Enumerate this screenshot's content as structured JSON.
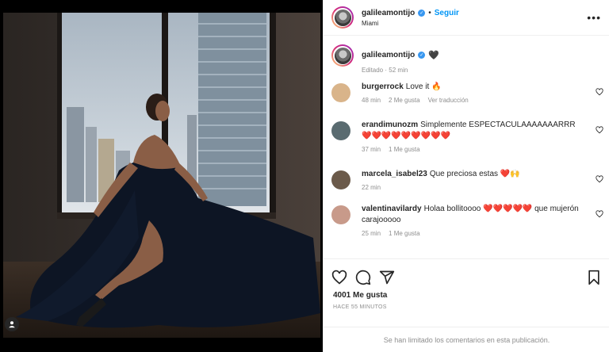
{
  "header": {
    "username": "galileamontijo",
    "separator": "•",
    "follow_label": "Seguir",
    "location": "Miami",
    "more_label": "•••"
  },
  "caption": {
    "username": "galileamontijo",
    "text": "🖤",
    "edited": "Editado",
    "separator": "·",
    "time": "52 min"
  },
  "comments": [
    {
      "username": "burgerrock",
      "text": "Love it 🔥",
      "time": "48 min",
      "likes": "2 Me gusta",
      "translate": "Ver traducción",
      "avatar_color": "#d9b48a"
    },
    {
      "username": "erandimunozm",
      "text": "Simplemente ESPECTACULAAAAAAARRR ❤️❤️❤️❤️❤️❤️❤️❤️❤️",
      "time": "37 min",
      "likes": "1 Me gusta",
      "avatar_color": "#5a6b70"
    },
    {
      "username": "marcela_isabel23",
      "text": "Que preciosa estas ❤️🙌",
      "time": "22 min",
      "avatar_color": "#6b5a4a"
    },
    {
      "username": "valentinavilardy",
      "text": "Holaa bollitoooo ❤️❤️❤️❤️❤️ que mujerón carajooooo",
      "time": "25 min",
      "likes": "1 Me gusta",
      "avatar_color": "#c89a8a"
    }
  ],
  "actions": {
    "like_icon": "heart-icon",
    "comment_icon": "comment-icon",
    "share_icon": "share-icon",
    "save_icon": "bookmark-icon",
    "likes_count": "4001 Me gusta",
    "posted": "HACE 55 MINUTOS",
    "limited": "Se han limitado los comentarios en esta publicación."
  },
  "colors": {
    "accent": "#0095f6",
    "verified": "#3897f0",
    "muted": "#8e8e8e",
    "text": "#262626"
  }
}
